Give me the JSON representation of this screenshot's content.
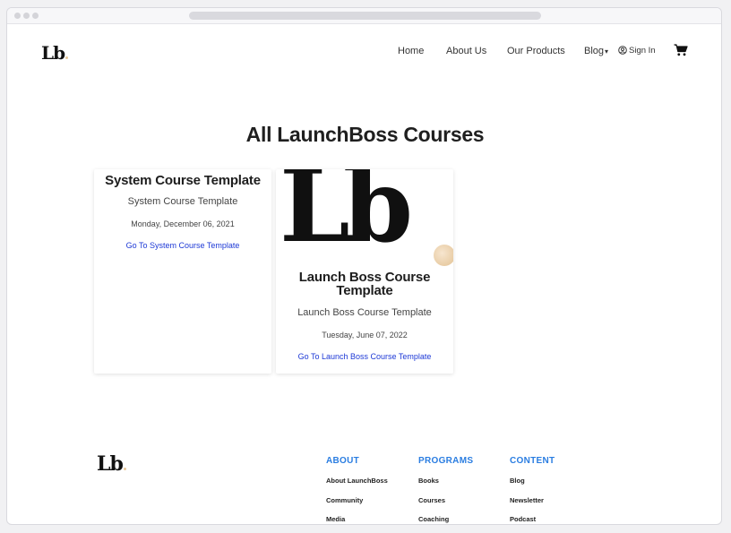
{
  "brand": {
    "logo_text": "Lb"
  },
  "nav": {
    "home": "Home",
    "about": "About Us",
    "products": "Our Products",
    "blog": "Blog",
    "sign_in": "Sign In"
  },
  "icons": {
    "user": "user-circle-icon",
    "cart": "shopping-cart-icon",
    "caret": "chevron-down-icon"
  },
  "page": {
    "title": "All LaunchBoss Courses"
  },
  "courses": [
    {
      "heading": "System Course Template",
      "subtitle": "System Course Template",
      "date": "Monday, December 06, 2021",
      "link": "Go To System Course Template"
    },
    {
      "image_text": "Lb",
      "heading": "Launch Boss Course Template",
      "subtitle": "Launch Boss Course Template",
      "date": "Tuesday, June 07, 2022",
      "link": "Go To Launch Boss Course Template"
    }
  ],
  "footer": {
    "columns": [
      {
        "heading": "ABOUT",
        "items": [
          "About LaunchBoss",
          "Community",
          "Media"
        ]
      },
      {
        "heading": "PROGRAMS",
        "items": [
          "Books",
          "Courses",
          "Coaching"
        ]
      },
      {
        "heading": "CONTENT",
        "items": [
          "Blog",
          "Newsletter",
          "Podcast"
        ]
      }
    ]
  },
  "colors": {
    "accent_link": "#1d39d6",
    "footer_heading": "#2a7de1",
    "logo_dot": "#e8c89a"
  }
}
